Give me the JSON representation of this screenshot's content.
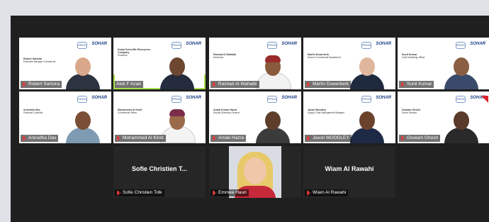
{
  "participants": [
    {
      "name": "Robert Sartstra",
      "slide_name": "Robert Sartstra",
      "slide_title": "Executive Manager Commercial"
    },
    {
      "name": "Alok F Azad",
      "slide_name": "Dubai Scientific Resources Company",
      "slide_title": "President"
    },
    {
      "name": "Rashad Al Wahaibi",
      "slide_name": "Rashad Al Wahaibi",
      "slide_title": "Moderator"
    },
    {
      "name": "Martin Duwerkerk",
      "slide_name": "Martin Duwerkerk",
      "slide_title": "Head of Commercial Department"
    },
    {
      "name": "Sunil Kumar",
      "slide_name": "Sunil Kumar",
      "slide_title": "Chief Marketing Officer"
    },
    {
      "name": "Anirudha Das",
      "slide_name": "Anirudha Das",
      "slide_title": "Financial Controller"
    },
    {
      "name": "Mohammed Al Kindi",
      "slide_name": "Mohammed Al Kindi",
      "slide_title": "Commercial Officer"
    },
    {
      "name": "Amab Hazra",
      "slide_name": "Amab Kumar Hazra",
      "slide_title": "Deputy Secretary General"
    },
    {
      "name": "Jason MOODLEY",
      "slide_name": "Jason Moodley",
      "slide_title": "Supply Chain Management Manager"
    },
    {
      "name": "Goutam Ghosh",
      "slide_name": "Goutam Ghosh",
      "slide_title": "Senior Director"
    },
    {
      "name": "Sofie Christien Tolk",
      "display": "Sofie Christien T..."
    },
    {
      "name": "Emmee Hauri"
    },
    {
      "name": "Wiam Al Rawahi",
      "display": "Wiam Al Rawahi"
    }
  ],
  "logos": {
    "left": "PROS",
    "right": "SOHAR"
  },
  "colors": {
    "active_outline": "#a7e04a",
    "mic_muted": "#e23b3b"
  }
}
